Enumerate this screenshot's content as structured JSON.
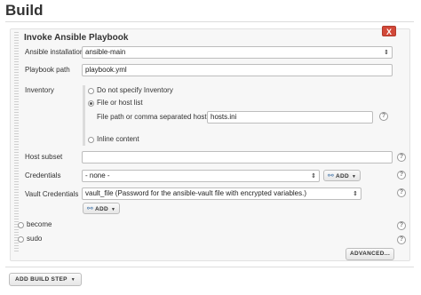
{
  "section": {
    "title": "Build"
  },
  "step": {
    "title": "Invoke Ansible Playbook",
    "delete_label": "X",
    "ansible_installation": {
      "label": "Ansible installation",
      "value": "ansible-main"
    },
    "playbook_path": {
      "label": "Playbook path",
      "value": "playbook.yml"
    },
    "inventory": {
      "label": "Inventory",
      "options": [
        {
          "label": "Do not specify Inventory",
          "checked": false
        },
        {
          "label": "File or host list",
          "checked": true
        },
        {
          "label": "Inline content",
          "checked": false
        }
      ],
      "file_label": "File path or comma separated host list",
      "file_value": "hosts.ini"
    },
    "host_subset": {
      "label": "Host subset",
      "value": ""
    },
    "credentials": {
      "label": "Credentials",
      "value": "- none -",
      "add_label": "ADD"
    },
    "vault_credentials": {
      "label": "Vault Credentials",
      "value": "vault_file (Password for the ansible-vault file with encrypted variables.)",
      "add_label": "ADD"
    },
    "become_label": "become",
    "sudo_label": "sudo",
    "advanced_label": "ADVANCED..."
  },
  "add_build_step_label": "ADD BUILD STEP",
  "help_glyph": "?",
  "icons": {
    "help": "help-icon",
    "key": "key-icon",
    "caret": "caret-down-icon"
  },
  "colors": {
    "delete_button": "#d24939",
    "key_icon": "#3a6ea5"
  }
}
